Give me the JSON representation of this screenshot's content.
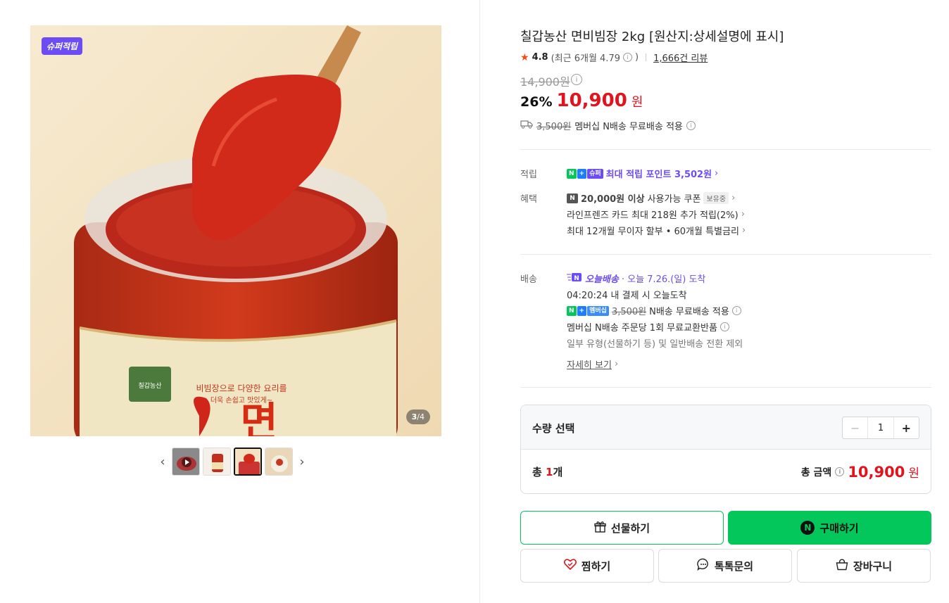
{
  "gallery": {
    "badge": "슈퍼적립",
    "counter_current": "3",
    "counter_total": "/4",
    "prev_icon": "chevron-left-icon",
    "next_icon": "chevron-right-icon",
    "main_image": "gochujang-jar-with-wooden-spoon",
    "jar_label_text": "비빔장으로 다양한 요리를",
    "jar_label_text2": "더욱 손쉽고 맛있게~",
    "jar_big_text": "면",
    "jar_brand": "칠갑농산",
    "thumbnails": [
      "video-thumb",
      "jar-thumb",
      "spoon-thumb",
      "noodle-thumb"
    ]
  },
  "product": {
    "title": "칠갑농산 면비빔장 2kg [원산지:상세설명에 표시]",
    "rating": "4.8",
    "recent_rating": "(최근 6개월 4.79",
    "recent_close": ")",
    "review_count": "1,666건 리뷰",
    "original_price": "14,900원",
    "discount": "26%",
    "price": "10,900",
    "won": "원",
    "ship_fee": "3,500원",
    "ship_text": "멤버십 N배송 무료배송 적용"
  },
  "benefits": {
    "points_label": "적립",
    "points_text": "최대 적립 포인트 3,502원",
    "benefit_label": "혜택",
    "coupon_bold": "20,000원 이상",
    "coupon_text": "사용가능 쿠폰",
    "coupon_tag": "보유중",
    "card_text": "라인프렌즈 카드 최대 218원 추가 적립(2%)",
    "installment_text": "최대 12개월 무이자 할부 • 60개월 특별금리"
  },
  "delivery": {
    "label": "배송",
    "today_label": "오늘배송",
    "arrival": "· 오늘 7.26.(일) 도착",
    "deadline": "04:20:24  내 결제 시 오늘도착",
    "fee_strike": "3,500원",
    "fee_text": "N배송 무료배송 적용",
    "return_text": "멤버십 N배송 주문당 1회 무료교환반품",
    "excluded_text": "일부 유형(선물하기 등) 및 일반배송 전환 제외",
    "details_link": "자세히 보기"
  },
  "quantity": {
    "label": "수량 선택",
    "value": "1",
    "total_prefix": "총 ",
    "total_count": "1",
    "total_suffix": "개",
    "amount_label": "총 금액",
    "amount_value": "10,900",
    "amount_won": "원"
  },
  "actions": {
    "gift": "선물하기",
    "buy": "구매하기",
    "wish": "찜하기",
    "talk": "톡톡문의",
    "cart": "장바구니"
  },
  "colors": {
    "accent_green": "#03c75a",
    "price_red": "#e1141e",
    "purple": "#6b4cf5"
  }
}
